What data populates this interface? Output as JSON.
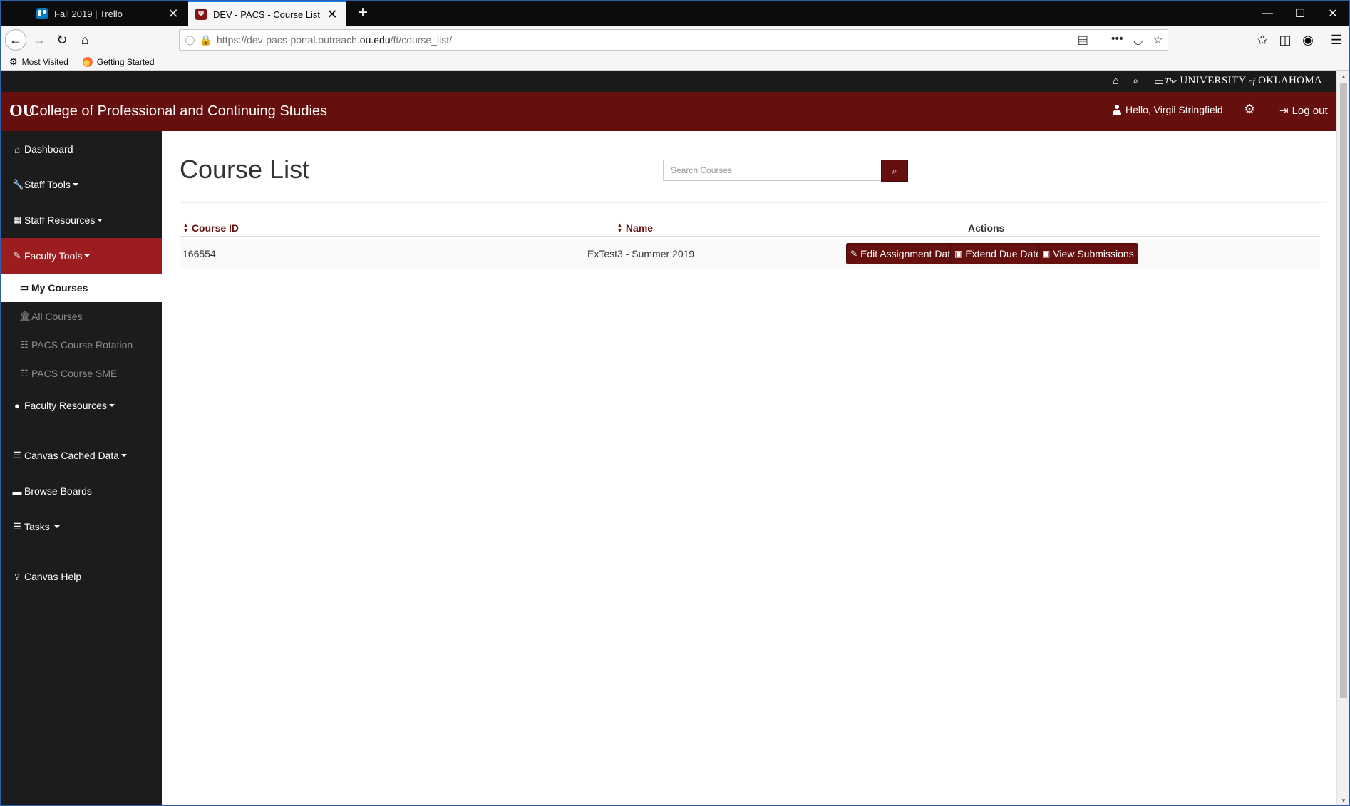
{
  "browser": {
    "tabs": [
      {
        "title": "Fall 2019 | Trello",
        "close": "✕"
      },
      {
        "title": "DEV - PACS - Course List",
        "close": "✕"
      }
    ],
    "new_tab": "+",
    "window_controls": {
      "minimize": "—",
      "maximize": "☐",
      "close": "✕"
    },
    "url_prefix": "https://dev-pacs-portal.outreach.",
    "url_domain": "ou.edu",
    "url_suffix": "/ft/course_list/",
    "bookmarks": [
      {
        "label": "Most Visited",
        "icon": "gear-icon"
      },
      {
        "label": "Getting Started",
        "icon": "firefox-icon"
      }
    ]
  },
  "site": {
    "top_strip": {
      "wordmark_pre": "The",
      "wordmark_main": "UNIVERSITY",
      "wordmark_of": "of",
      "wordmark_end": "OKLAHOMA"
    },
    "logo_text": "OU",
    "brand": "College of Professional and Continuing Studies",
    "greeting": "Hello, Virgil Stringfield",
    "logout": "Log out",
    "accent_color": "#650f0f"
  },
  "sidebar": {
    "dashboard": "Dashboard",
    "staff_tools": "Staff Tools",
    "staff_resources": "Staff Resources",
    "faculty_tools": "Faculty Tools",
    "my_courses": "My Courses",
    "all_courses": "All Courses",
    "course_rotation": "PACS Course Rotation",
    "course_sme": "PACS Course SME",
    "faculty_resources": "Faculty Resources",
    "canvas_cached_data": "Canvas Cached Data",
    "browse_boards": "Browse Boards",
    "tasks": "Tasks",
    "canvas_help": "Canvas Help"
  },
  "main": {
    "title": "Course List",
    "search_placeholder": "Search Courses",
    "table": {
      "headers": {
        "course_id": "Course ID",
        "name": "Name",
        "actions": "Actions"
      },
      "rows": [
        {
          "course_id": "166554",
          "name": "ExTest3 - Summer 2019"
        }
      ],
      "actions": {
        "edit_dates": "Edit Assignment Dates",
        "extend_dates": "Extend Due Dates",
        "view_submissions": "View Submissions"
      }
    }
  }
}
